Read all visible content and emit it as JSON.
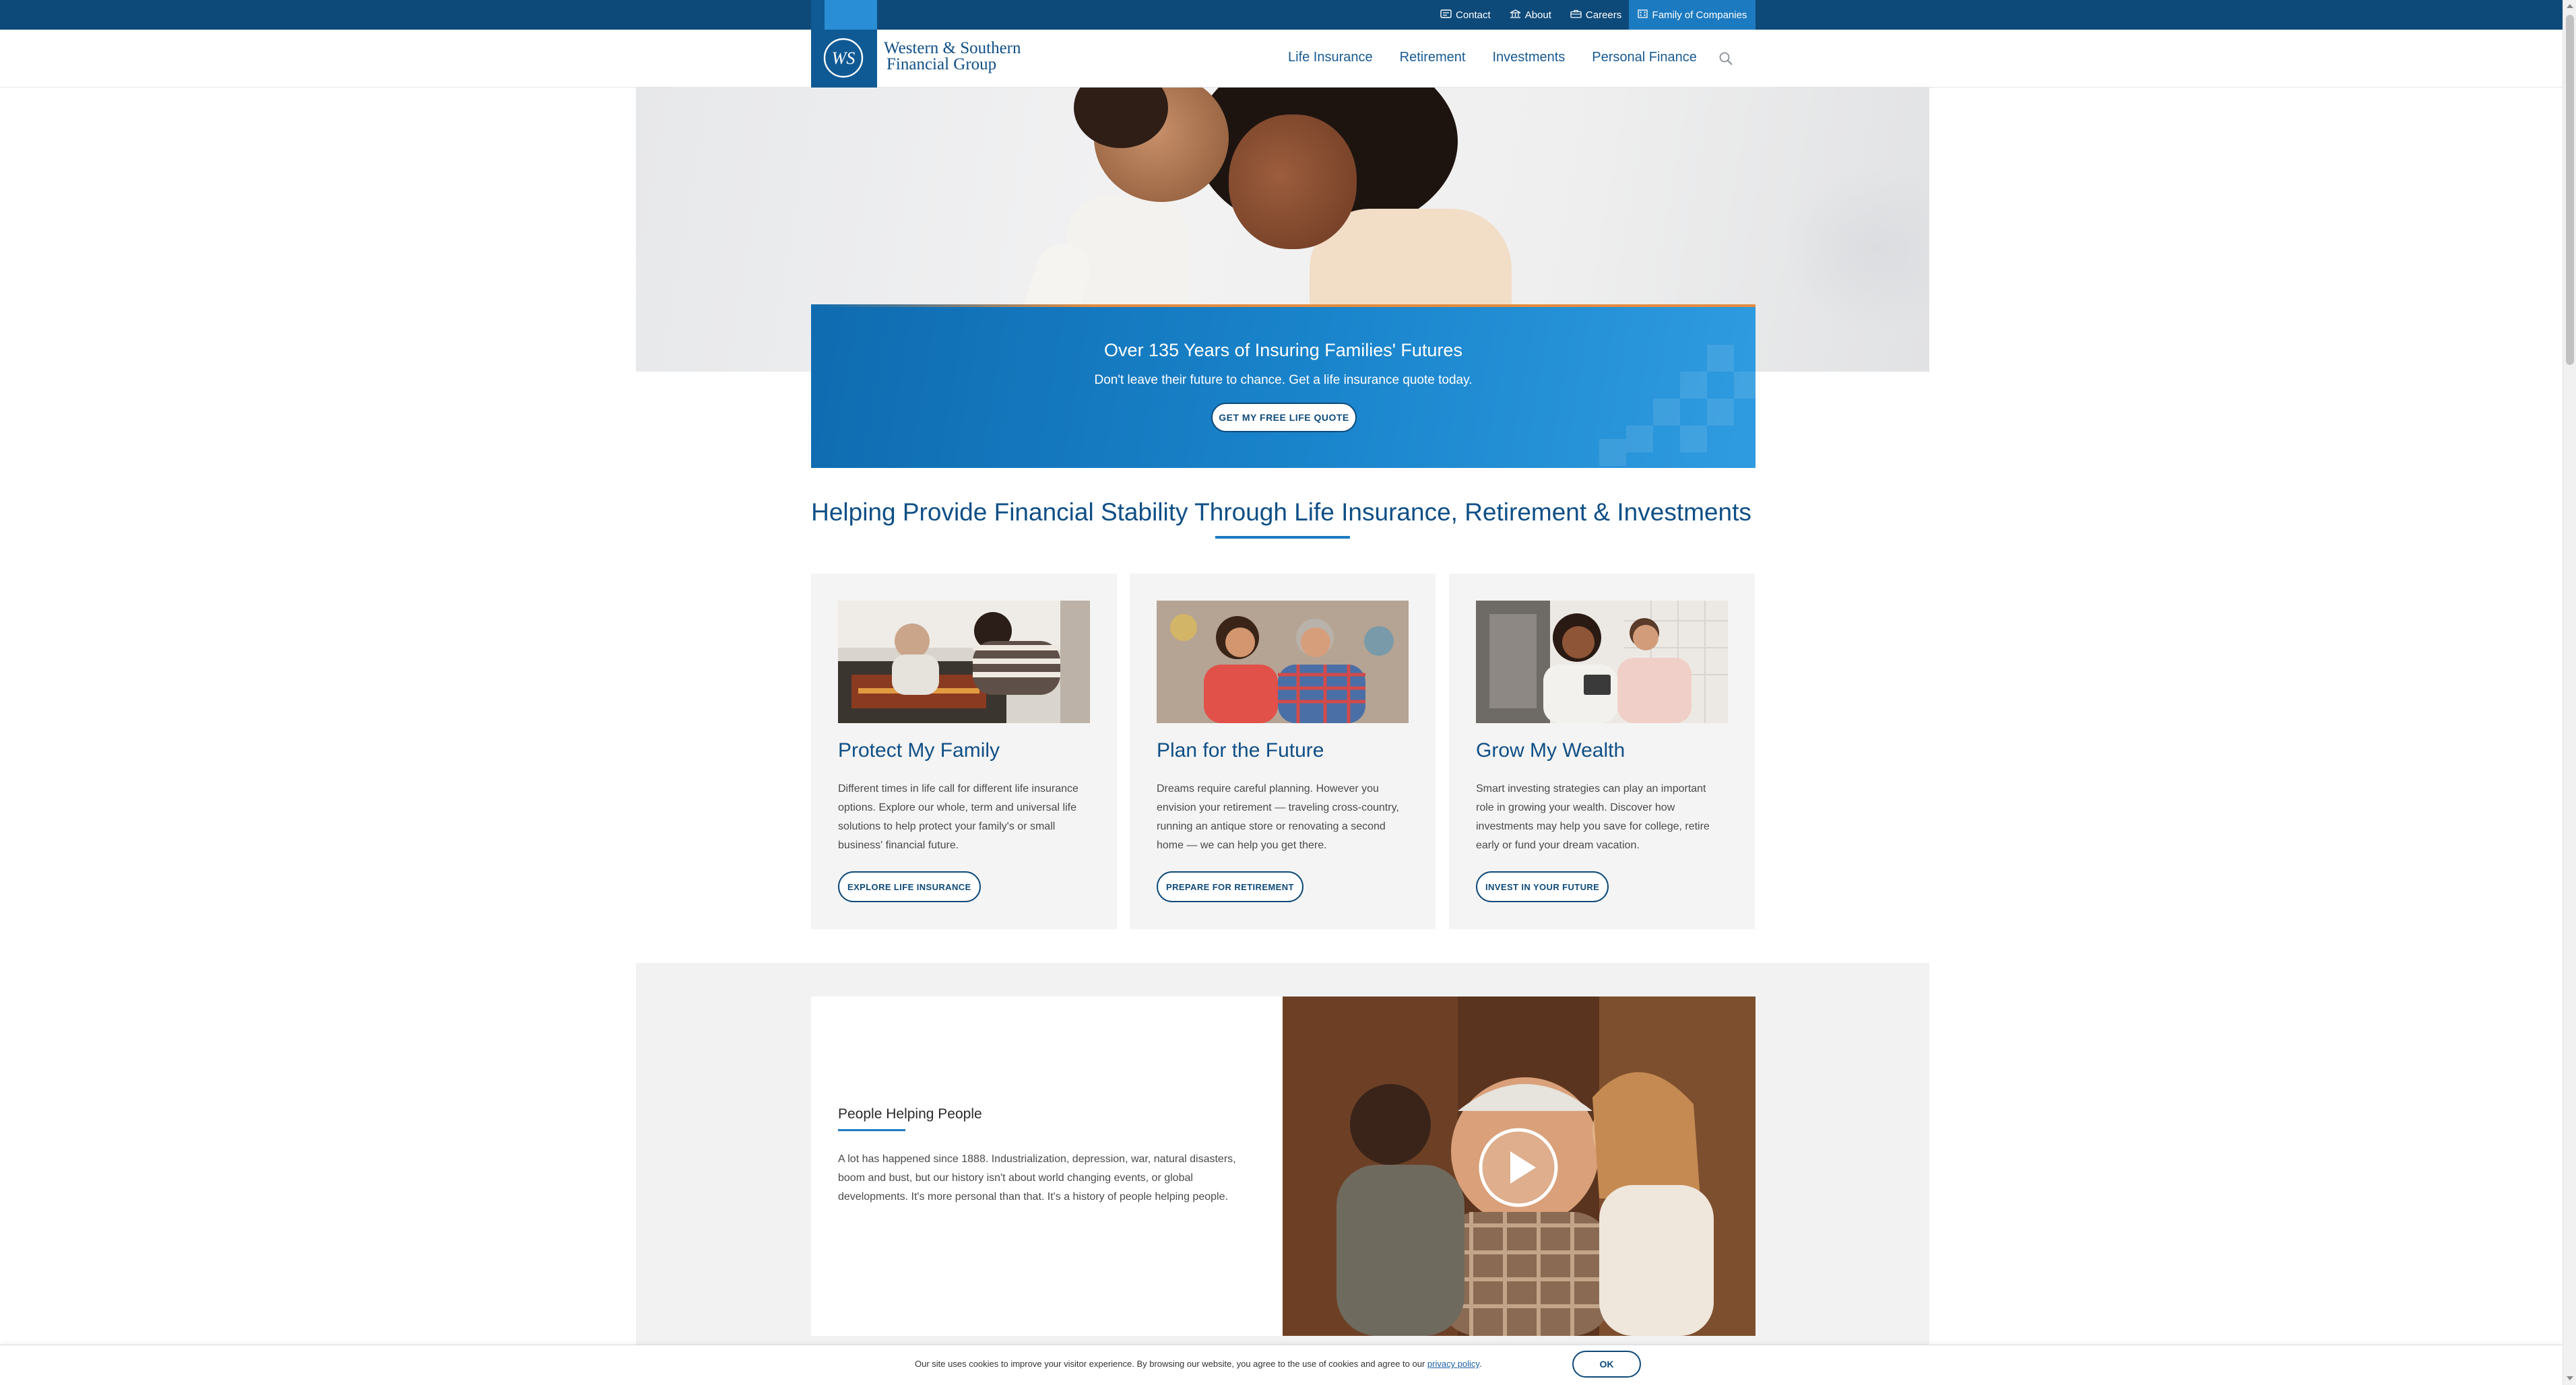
{
  "colors": {
    "brand_dark": "#0e4a79",
    "brand": "#0f5a95",
    "accent": "#1c7ac0",
    "heading": "#0f4f86",
    "card_bg": "#f4f4f4"
  },
  "topbar": {
    "links": [
      {
        "label": "Contact",
        "icon": "contact-card-icon"
      },
      {
        "label": "About",
        "icon": "building-icon"
      },
      {
        "label": "Careers",
        "icon": "briefcase-icon"
      }
    ],
    "family_label": "Family of Companies",
    "family_icon": "grid-building-icon"
  },
  "logo": {
    "monogram": "WS",
    "line1": "Western & Southern",
    "line2": "Financial Group"
  },
  "nav": {
    "items": [
      "Life Insurance",
      "Retirement",
      "Investments",
      "Personal Finance"
    ],
    "search_icon": "search-icon"
  },
  "promo": {
    "title": "Over 135 Years of Insuring Families' Futures",
    "subtitle": "Don't leave their future to chance. Get a life insurance quote today.",
    "button": "GET MY FREE LIFE QUOTE"
  },
  "section": {
    "heading": "Helping Provide Financial Stability Through Life Insurance, Retirement & Investments"
  },
  "cards": [
    {
      "title": "Protect My Family",
      "text": "Different times in life call for different life insurance options. Explore our whole, term and universal life solutions to help protect your family's or small business' financial future.",
      "button": "EXPLORE LIFE INSURANCE"
    },
    {
      "title": "Plan for the Future",
      "text": "Dreams require careful planning. However you envision your retirement — traveling cross-country, running an antique store or renovating a second home — we can help you get there.",
      "button": "PREPARE FOR RETIREMENT"
    },
    {
      "title": "Grow My Wealth",
      "text": "Smart investing strategies can play an important role in growing your wealth. Discover how investments may help you save for college, retire early or fund your dream vacation.",
      "button": "INVEST IN YOUR FUTURE"
    }
  ],
  "people": {
    "title": "People Helping People",
    "text": "A lot has happened since 1888. Industrialization, depression, war, natural disasters, boom and bust, but our history isn't about world changing events, or global developments. It's more personal than that. It's a history of people helping people."
  },
  "cookie": {
    "text_before": "Our site uses cookies to improve your visitor experience. By browsing our website, you agree to the use of cookies and agree to our ",
    "link": "privacy policy",
    "text_after": ".",
    "ok": "OK"
  }
}
